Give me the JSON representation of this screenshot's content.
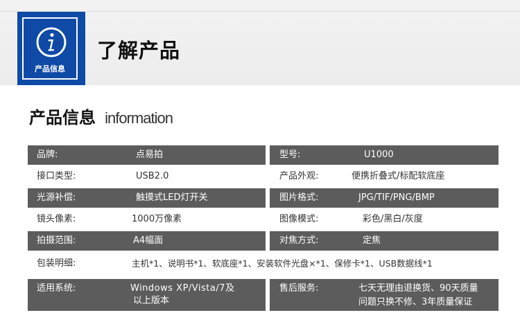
{
  "header": {
    "badge_label": "产品信息",
    "badge_icon": "info-icon",
    "title": "了解产品"
  },
  "section": {
    "title_cn": "产品信息",
    "title_en": "information"
  },
  "specs": [
    {
      "label": "品牌:",
      "value": "点易拍"
    },
    {
      "label": "型号:",
      "value": "U1000"
    },
    {
      "label": "接口类型:",
      "value": "USB2.0"
    },
    {
      "label": "产品外观:",
      "value": "便携折叠式/标配软底座"
    },
    {
      "label": "光源补偿:",
      "value": "触摸式LED灯开关"
    },
    {
      "label": "图片格式:",
      "value": "JPG/TIF/PNG/BMP"
    },
    {
      "label": "镜头像素:",
      "value": "1000万像素"
    },
    {
      "label": "图像模式:",
      "value": "彩色/黑白/灰度"
    },
    {
      "label": "拍摄范围:",
      "value": "A4幅面"
    },
    {
      "label": "对焦方式:",
      "value": "定焦"
    },
    {
      "label": "包装明细:",
      "value": "主机*1、说明书*1、软底座*1、安装软件光盘×*1、保修卡*1、USB数据线*1"
    },
    {
      "label": "适用系统:",
      "value": "Windows XP/Vista/7及",
      "value2": "以上版本"
    },
    {
      "label": "售后服务:",
      "value": "七天无理由退换货、90天质量",
      "value2": "问题只换不修、3年质量保证"
    }
  ],
  "colors": {
    "badge": "#0e4aa6",
    "dark_row": "#5c5c5c"
  }
}
